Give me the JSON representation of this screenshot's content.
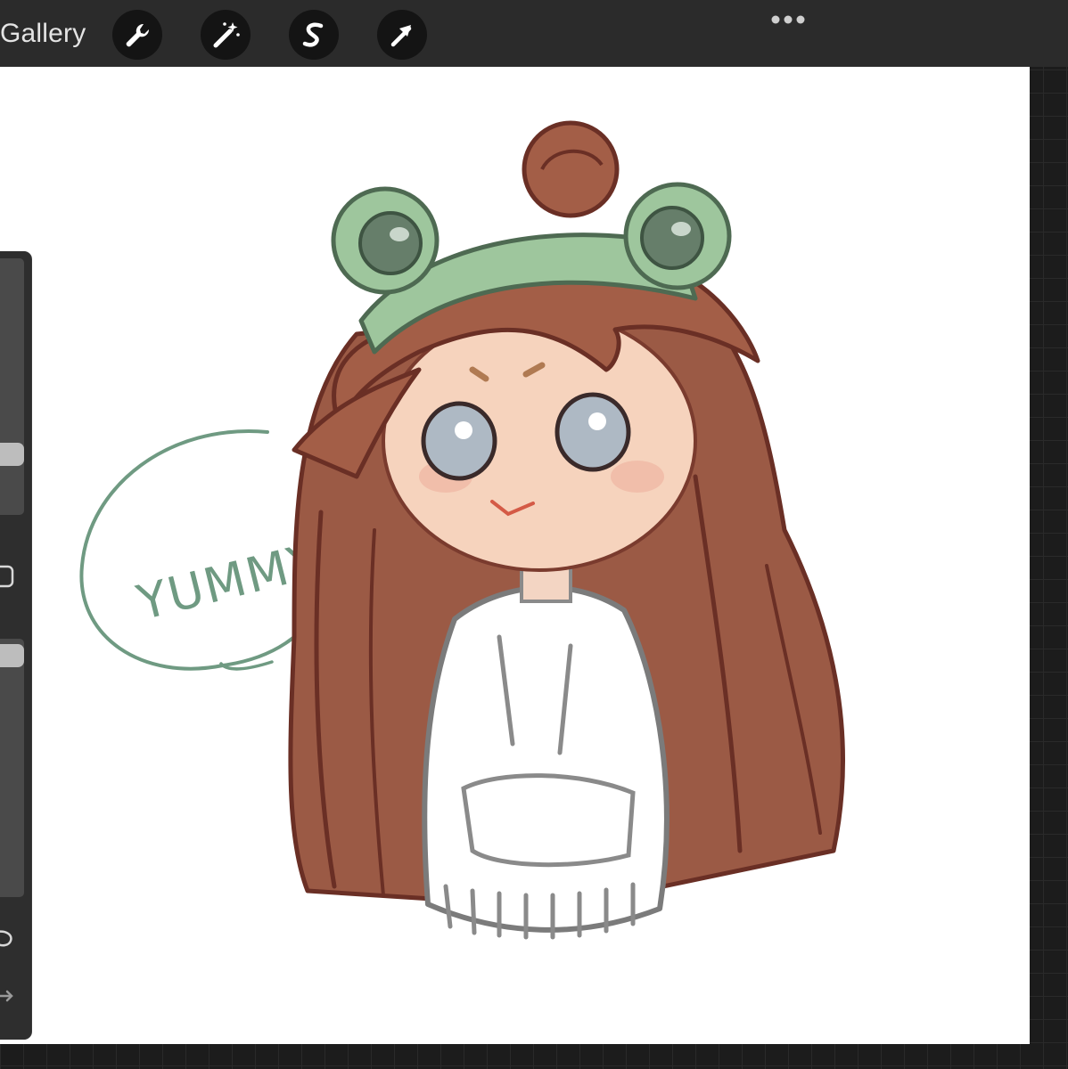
{
  "topbar": {
    "gallery_label": "Gallery",
    "tools": [
      {
        "name": "actions",
        "icon": "wrench-icon"
      },
      {
        "name": "adjustments",
        "icon": "magic-wand-icon"
      },
      {
        "name": "selection",
        "icon": "selection-s-icon"
      },
      {
        "name": "transform",
        "icon": "arrow-cursor-icon"
      }
    ],
    "more_icon": "ellipsis-icon"
  },
  "canvas": {
    "speech_bubble_text": "YUMMY"
  },
  "sidebar": {
    "brush_size_icon": "slider-icon",
    "modify_icon": "square-icon",
    "opacity_icon": "slider-icon",
    "undo_icon": "undo-icon",
    "redo_icon": "redo-icon"
  },
  "colors": {
    "toolbar": "#2b2b2b",
    "button": "#141414",
    "canvas": "#ffffff",
    "bubble_green": "#6f9a82",
    "hair": "#9b5a45",
    "frog_band": "#9ec69d"
  }
}
